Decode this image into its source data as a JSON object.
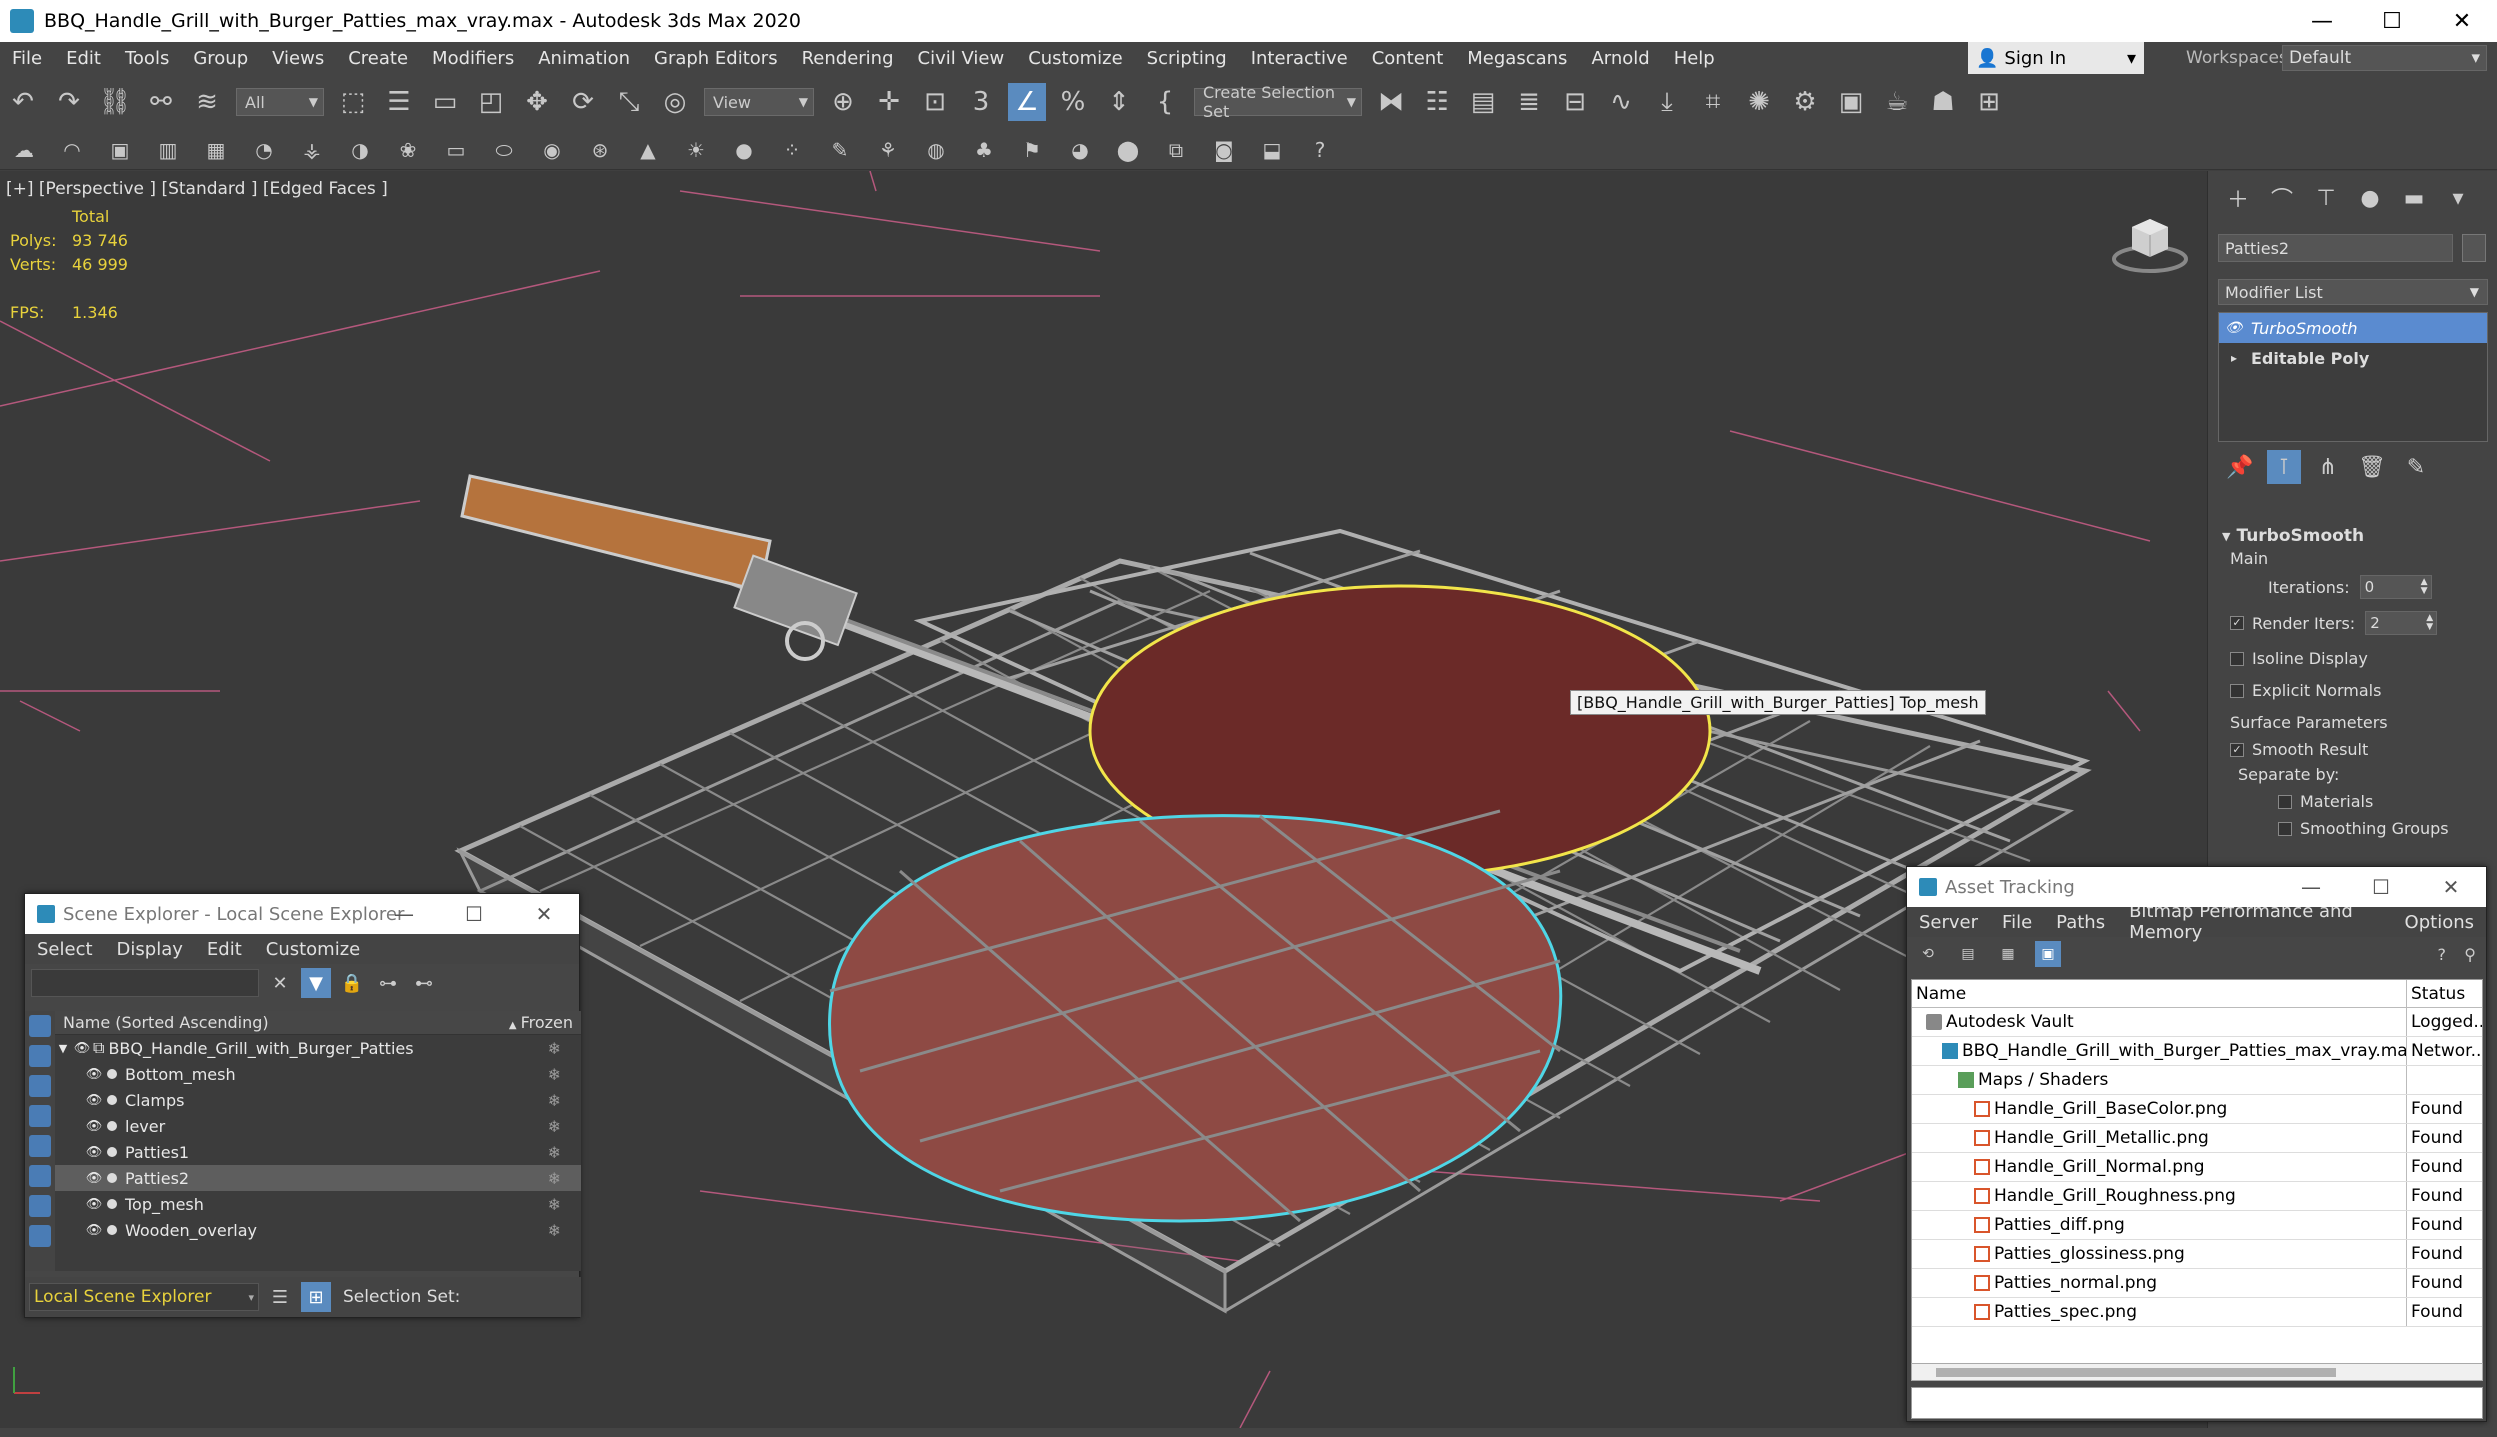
{
  "titlebar": {
    "title": "BBQ_Handle_Grill_with_Burger_Patties_max_vray.max - Autodesk 3ds Max 2020",
    "minimize": "—",
    "maximize": "☐",
    "close": "✕"
  },
  "menubar": {
    "items": [
      "File",
      "Edit",
      "Tools",
      "Group",
      "Views",
      "Create",
      "Modifiers",
      "Animation",
      "Graph Editors",
      "Rendering",
      "Civil View",
      "Customize",
      "Scripting",
      "Interactive",
      "Content",
      "Megascans",
      "Arnold",
      "Help"
    ],
    "sign_in": "Sign In",
    "workspaces_label": "Workspaces:",
    "workspace_value": "Default"
  },
  "toolbar": {
    "filter_value": "All",
    "ref_coord_value": "View",
    "selection_set_placeholder": "Create Selection Set"
  },
  "viewport": {
    "label": "[+] [Perspective ] [Standard ] [Edged Faces ]",
    "stats_header": "Total",
    "polys_label": "Polys:",
    "polys_value": "93 746",
    "verts_label": "Verts:",
    "verts_value": "46 999",
    "fps_label": "FPS:",
    "fps_value": "1.346",
    "tooltip": "[BBQ_Handle_Grill_with_Burger_Patties] Top_mesh"
  },
  "command_panel": {
    "object_name": "Patties2",
    "modifier_list": "Modifier List",
    "stack": [
      {
        "label": "TurboSmooth",
        "selected": true
      },
      {
        "label": "Editable Poly",
        "selected": false
      }
    ],
    "rollout_title": "TurboSmooth",
    "main_label": "Main",
    "iterations_label": "Iterations:",
    "iterations_value": "0",
    "render_iters_label": "Render Iters:",
    "render_iters_value": "2",
    "isoline_label": "Isoline Display",
    "explicit_normals_label": "Explicit Normals",
    "surface_params_label": "Surface Parameters",
    "smooth_result_label": "Smooth Result",
    "separate_by_label": "Separate by:",
    "materials_label": "Materials",
    "smoothing_groups_label": "Smoothing Groups"
  },
  "scene_explorer": {
    "title": "Scene Explorer - Local Scene Explorer",
    "menu": [
      "Select",
      "Display",
      "Edit",
      "Customize"
    ],
    "col_name": "Name (Sorted Ascending)",
    "col_frozen": "Frozen",
    "root": "BBQ_Handle_Grill_with_Burger_Patties",
    "children": [
      "Bottom_mesh",
      "Clamps",
      "lever",
      "Patties1",
      "Patties2",
      "Top_mesh",
      "Wooden_overlay"
    ],
    "selected_child": "Patties2",
    "footer_explorer": "Local Scene Explorer",
    "selection_set_label": "Selection Set:"
  },
  "asset_tracking": {
    "title": "Asset Tracking",
    "menu": [
      "Server",
      "File",
      "Paths",
      "Bitmap Performance and Memory",
      "Options"
    ],
    "col_name": "Name",
    "col_status": "Status",
    "rows": [
      {
        "name": "Autodesk Vault",
        "status": "Logged...",
        "indent": 0,
        "icon": "vault-icon"
      },
      {
        "name": "BBQ_Handle_Grill_with_Burger_Patties_max_vray.max",
        "status": "Networ...",
        "indent": 1,
        "icon": "max-file-icon"
      },
      {
        "name": "Maps / Shaders",
        "status": "",
        "indent": 2,
        "icon": "folder-icon"
      },
      {
        "name": "Handle_Grill_BaseColor.png",
        "status": "Found",
        "indent": 3,
        "icon": "png-file-icon"
      },
      {
        "name": "Handle_Grill_Metallic.png",
        "status": "Found",
        "indent": 3,
        "icon": "png-file-icon"
      },
      {
        "name": "Handle_Grill_Normal.png",
        "status": "Found",
        "indent": 3,
        "icon": "png-file-icon"
      },
      {
        "name": "Handle_Grill_Roughness.png",
        "status": "Found",
        "indent": 3,
        "icon": "png-file-icon"
      },
      {
        "name": "Patties_diff.png",
        "status": "Found",
        "indent": 3,
        "icon": "png-file-icon"
      },
      {
        "name": "Patties_glossiness.png",
        "status": "Found",
        "indent": 3,
        "icon": "png-file-icon"
      },
      {
        "name": "Patties_normal.png",
        "status": "Found",
        "indent": 3,
        "icon": "png-file-icon"
      },
      {
        "name": "Patties_spec.png",
        "status": "Found",
        "indent": 3,
        "icon": "png-file-icon"
      }
    ]
  },
  "colors": {
    "accent": "#5a8bbf",
    "selection_yellow": "#f2e54a",
    "selection_cyan": "#4fd6e6",
    "stats_yellow": "#e8d23c"
  }
}
